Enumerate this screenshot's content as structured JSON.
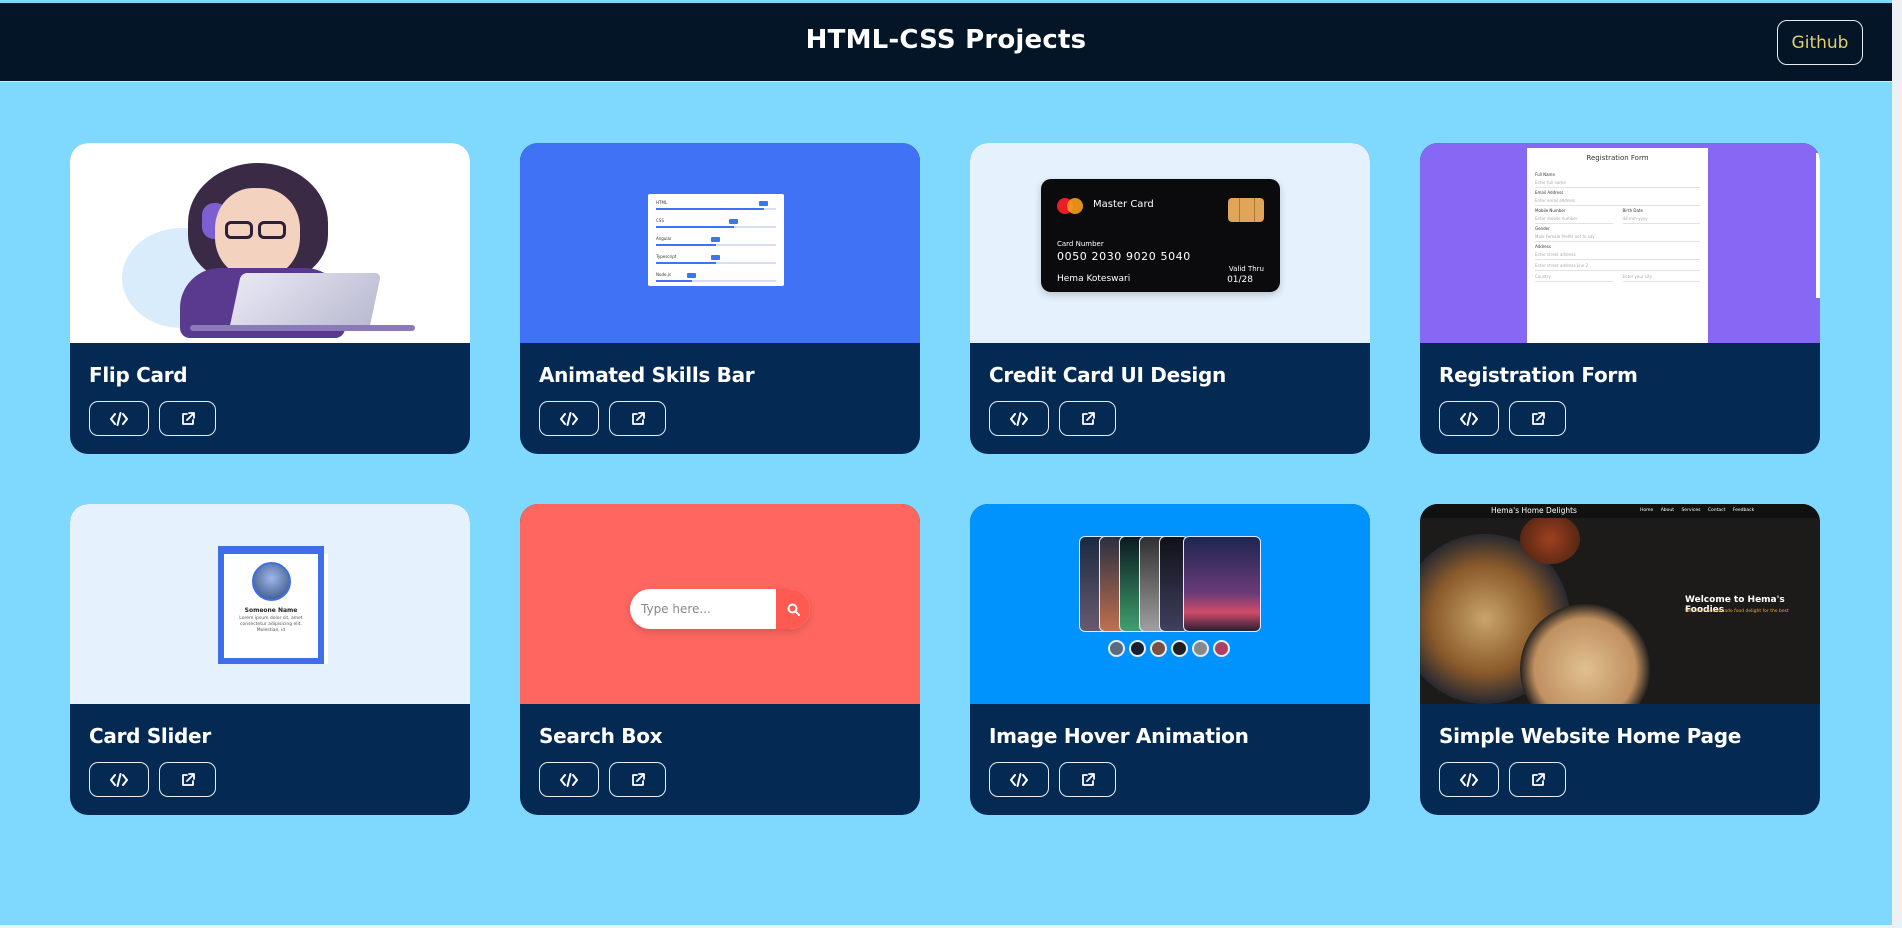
{
  "header": {
    "title": "HTML-CSS Projects",
    "github_label": "Github"
  },
  "cards": [
    {
      "title": "Flip Card"
    },
    {
      "title": "Animated Skills Bar"
    },
    {
      "title": "Credit Card UI Design"
    },
    {
      "title": "Registration Form"
    },
    {
      "title": "Card Slider"
    },
    {
      "title": "Search Box"
    },
    {
      "title": "Image Hover Animation"
    },
    {
      "title": "Simple Website Home Page"
    }
  ],
  "previews": {
    "skills": [
      {
        "label": "HTML",
        "pct": 0.9
      },
      {
        "label": "CSS",
        "pct": 0.65
      },
      {
        "label": "Angular",
        "pct": 0.5
      },
      {
        "label": "Typescript",
        "pct": 0.5
      },
      {
        "label": "Node.js",
        "pct": 0.3
      }
    ],
    "credit_card": {
      "brand": "Master Card",
      "number_label": "Card Number",
      "number": "0050 2030 9020 5040",
      "holder": "Hema Koteswari",
      "valid_label": "Valid Thru",
      "valid": "01/28"
    },
    "registration": {
      "title": "Registration Form",
      "full_name": "Full Name",
      "full_name_ph": "Enter full name",
      "email": "Email Address",
      "email_ph": "Enter email address",
      "mobile": "Mobile Number",
      "mobile_ph": "Enter mobile number",
      "birth": "Birth Date",
      "birth_ph": "dd-mm-yyyy",
      "gender": "Gender",
      "gender_options": "Male  Female  Prefer not to say",
      "address": "Address",
      "address_ph": "Enter street address",
      "address2_ph": "Enter street address line 2",
      "country": "Country",
      "city_ph": "Enter your city"
    },
    "slider": {
      "name": "Someone Name",
      "text": "Lorem ipsum dolor sit, amet consectetur adipisicing elit. Molestiae, id"
    },
    "search": {
      "placeholder": "Type here..."
    },
    "website": {
      "brand": "Hema's Home Delights",
      "nav": "Home About Services Contact Feedback",
      "headline": "Welcome to Hema's Foodies",
      "sub": "We serve homemade food delight for the best"
    }
  },
  "colors": {
    "background": "#7fd8fd",
    "header": "#031527",
    "card_body": "#042a54",
    "github_text": "#e2cf6a"
  }
}
